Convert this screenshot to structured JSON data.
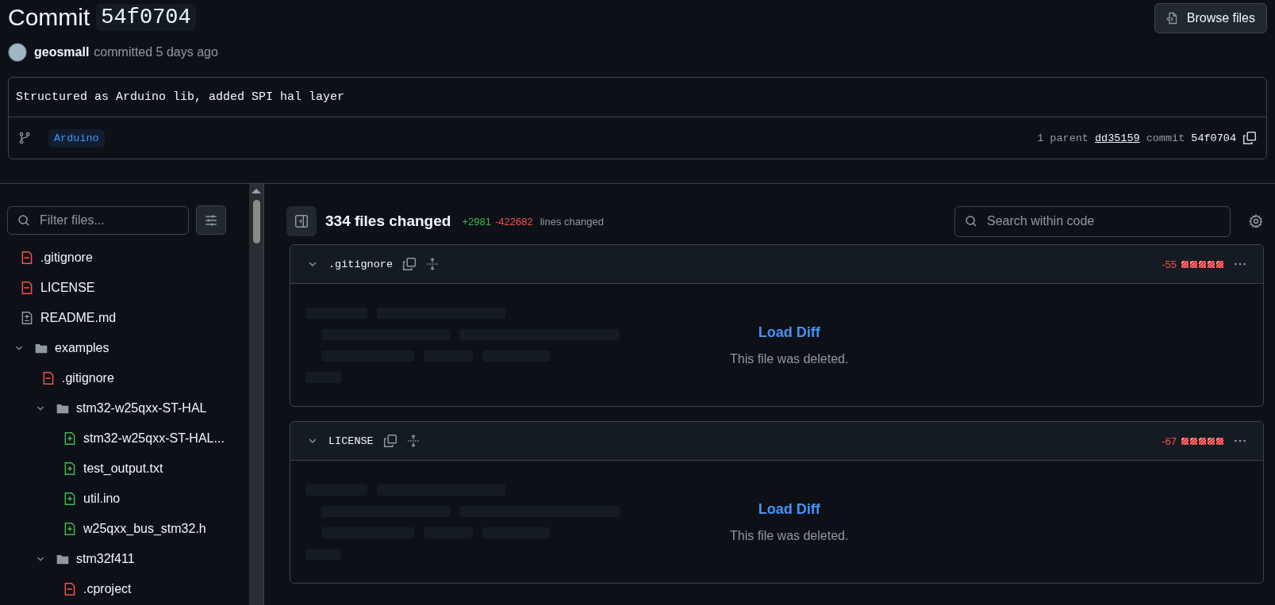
{
  "header": {
    "title": "Commit",
    "hash": "54f0704",
    "browse_button": "Browse files"
  },
  "author": {
    "name": "geosmall",
    "action": "committed 5 days ago"
  },
  "commit_box": {
    "message": "Structured as Arduino lib, added SPI hal layer",
    "branch": "Arduino",
    "parents_label": "1 parent",
    "parent_hash": "dd35159",
    "commit_label": "commit",
    "commit_hash": "54f0704"
  },
  "sidebar": {
    "filter": {
      "placeholder": "Filter files..."
    },
    "tree": [
      {
        "kind": "removed",
        "name": ".gitignore"
      },
      {
        "kind": "removed",
        "name": "LICENSE"
      },
      {
        "kind": "modified",
        "name": "README.md"
      },
      {
        "kind": "folder",
        "name": "examples",
        "expanded": true,
        "children": [
          {
            "kind": "removed",
            "name": ".gitignore"
          },
          {
            "kind": "folder",
            "name": "stm32-w25qxx-ST-HAL",
            "expanded": true,
            "children": [
              {
                "kind": "added",
                "name": "stm32-w25qxx-ST-HAL..."
              },
              {
                "kind": "added",
                "name": "test_output.txt"
              },
              {
                "kind": "added",
                "name": "util.ino"
              },
              {
                "kind": "added",
                "name": "w25qxx_bus_stm32.h"
              }
            ]
          },
          {
            "kind": "folder",
            "name": "stm32f411",
            "expanded": true,
            "children": [
              {
                "kind": "removed",
                "name": ".cproject"
              }
            ]
          }
        ]
      }
    ]
  },
  "toolbar": {
    "files_changed": "334 files changed",
    "additions": "+2981",
    "deletions": "-422682",
    "lines_label": "lines changed",
    "search": {
      "placeholder": "Search within code"
    }
  },
  "diffs": [
    {
      "name": ".gitignore",
      "expanded": true,
      "deletions": "-55",
      "load_label": "Load Diff",
      "note": "This file was deleted."
    },
    {
      "name": "LICENSE",
      "expanded": true,
      "deletions": "-67",
      "load_label": "Load Diff",
      "note": "This file was deleted."
    }
  ]
}
